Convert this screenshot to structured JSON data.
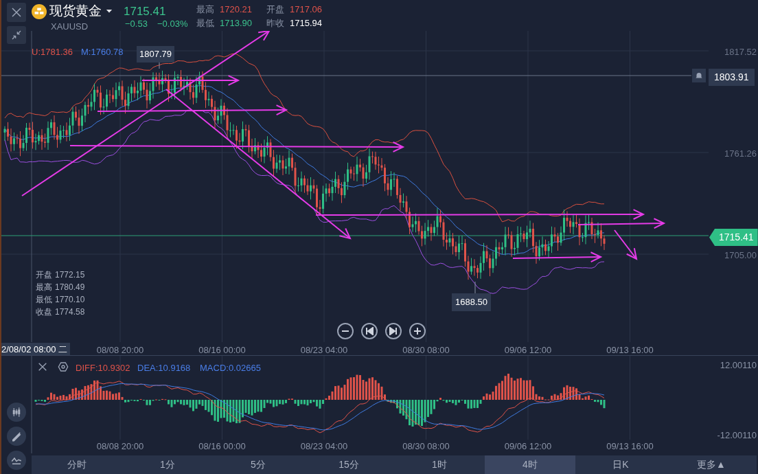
{
  "header": {
    "symbol_name": "现货黄金",
    "symbol_code": "XAUUSD",
    "last_price": "1715.41",
    "change": "−0.53",
    "change_percent": "−0.03%",
    "stats": [
      {
        "label": "最高",
        "value": "1720.21",
        "color": "#e0534a"
      },
      {
        "label": "开盘",
        "value": "1717.06",
        "color": "#e0534a"
      },
      {
        "label": "最低",
        "value": "1713.90",
        "color": "#3cc48e"
      },
      {
        "label": "昨收",
        "value": "1715.94",
        "color": "#ffffff"
      }
    ]
  },
  "bollinger_legend": [
    {
      "text": "U:1781.36",
      "color": "#e0534a"
    },
    {
      "text": "M:1760.78",
      "color": "#4a7ee8"
    }
  ],
  "price_axis": {
    "ticks": [
      "1817.52",
      "1761.26",
      "1705.00"
    ],
    "alert_price": "1803.91",
    "current_price": "1715.41"
  },
  "markers": {
    "high": "1807.79",
    "low": "1688.50"
  },
  "ohlc_info": [
    {
      "label": "开盘",
      "value": "1772.15"
    },
    {
      "label": "最高",
      "value": "1780.49"
    },
    {
      "label": "最低",
      "value": "1770.10"
    },
    {
      "label": "收盘",
      "value": "1774.58"
    }
  ],
  "crosshair_time": "2/08/02 08:00 二",
  "time_axis": [
    "08/08 20:00",
    "08/16 00:00",
    "08/23 04:00",
    "08/30 08:00",
    "09/06 12:00",
    "09/13 16:00"
  ],
  "macd": {
    "legend": [
      {
        "text": "DIFF:10.9302",
        "color": "#e0534a"
      },
      {
        "text": "DEA:10.9168",
        "color": "#4a7ee8"
      },
      {
        "text": "MACD:0.02665",
        "color": "#4a7ee8"
      }
    ],
    "axis": [
      "12.00110",
      "-12.00110"
    ],
    "time_axis": [
      "08/08 20:00",
      "08/16 00:00",
      "08/23 04:00",
      "08/30 08:00",
      "09/06 12:00",
      "09/13 16:00"
    ]
  },
  "periods": [
    {
      "label": "分时",
      "selected": false
    },
    {
      "label": "1分",
      "selected": false
    },
    {
      "label": "5分",
      "selected": false
    },
    {
      "label": "15分",
      "selected": false
    },
    {
      "label": "1时",
      "selected": false
    },
    {
      "label": "4时",
      "selected": true
    },
    {
      "label": "日K",
      "selected": false
    },
    {
      "label": "更多▲",
      "selected": false
    }
  ]
}
